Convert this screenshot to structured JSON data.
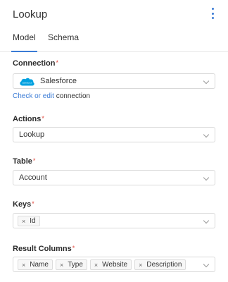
{
  "header": {
    "title": "Lookup",
    "menu_icon": "more-vertical-icon"
  },
  "tabs": [
    {
      "label": "Model",
      "active": true
    },
    {
      "label": "Schema",
      "active": false
    }
  ],
  "connection": {
    "label": "Connection",
    "required_mark": "*",
    "value": "Salesforce",
    "logo_text": "salesforce",
    "logo_icon": "salesforce-cloud-icon",
    "link_text": "Check or edit",
    "link_suffix": " connection"
  },
  "actions": {
    "label": "Actions",
    "required_mark": "*",
    "value": "Lookup"
  },
  "table": {
    "label": "Table",
    "required_mark": "*",
    "value": "Account"
  },
  "keys": {
    "label": "Keys",
    "required_mark": "*",
    "chips": [
      "Id"
    ]
  },
  "result_columns": {
    "label": "Result Columns",
    "required_mark": "*",
    "chips": [
      "Name",
      "Type",
      "Website",
      "Description"
    ]
  },
  "chip_remove_glyph": "×",
  "colors": {
    "accent": "#3a7bd5",
    "required": "#e0453a",
    "salesforce": "#00a1e0"
  }
}
